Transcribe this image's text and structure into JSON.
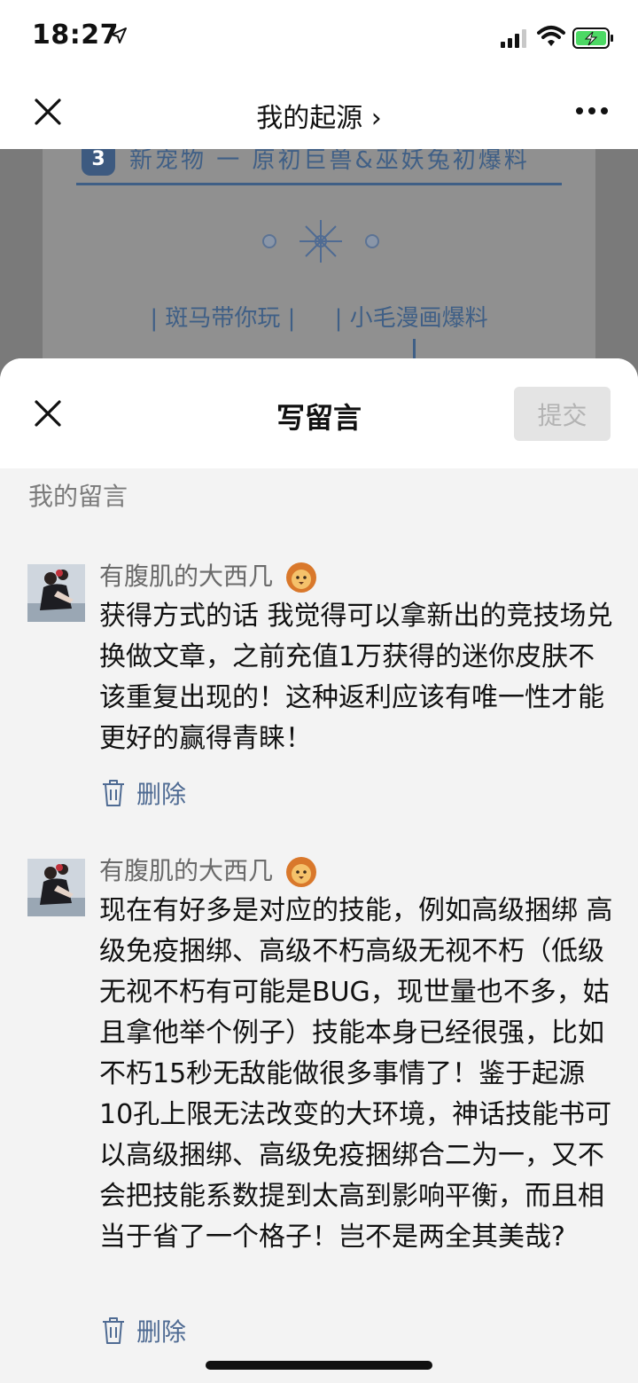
{
  "status_bar": {
    "time": "18:27"
  },
  "nav": {
    "title": "我的起源 ›"
  },
  "article": {
    "number": "3",
    "heading": "新宠物 一 原初巨兽&巫妖兔初爆料",
    "links": [
      "| 斑马带你玩 |",
      "| 小毛漫画爆料"
    ]
  },
  "sheet": {
    "title": "写留言",
    "submit_label": "提交",
    "section_label": "我的留言"
  },
  "comments": [
    {
      "name": "有腹肌的大西几",
      "text": "获得方式的话 我觉得可以拿新出的竞技场兑换做文章，之前充值1万获得的迷你皮肤不该重复出现的！这种返利应该有唯一性才能更好的赢得青睐！",
      "delete_label": "删除"
    },
    {
      "name": "有腹肌的大西几",
      "text": "现在有好多是对应的技能，例如高级捆绑 高级免疫捆绑、高级不朽高级无视不朽（低级无视不朽有可能是BUG，现世量也不多，姑且拿他举个例子）技能本身已经很强，比如不朽15秒无敌能做很多事情了！鉴于起源10孔上限无法改变的大环境，神话技能书可以高级捆绑、高级免疫捆绑合二为一，又不会把技能系数提到太高到影响平衡，而且相当于省了一个格子！岂不是两全其美哉?",
      "delete_label": "删除"
    }
  ],
  "colors": {
    "accent": "#4f6b93",
    "submit_disabled_bg": "#e4e4e4",
    "battery_green": "#4cd964"
  }
}
